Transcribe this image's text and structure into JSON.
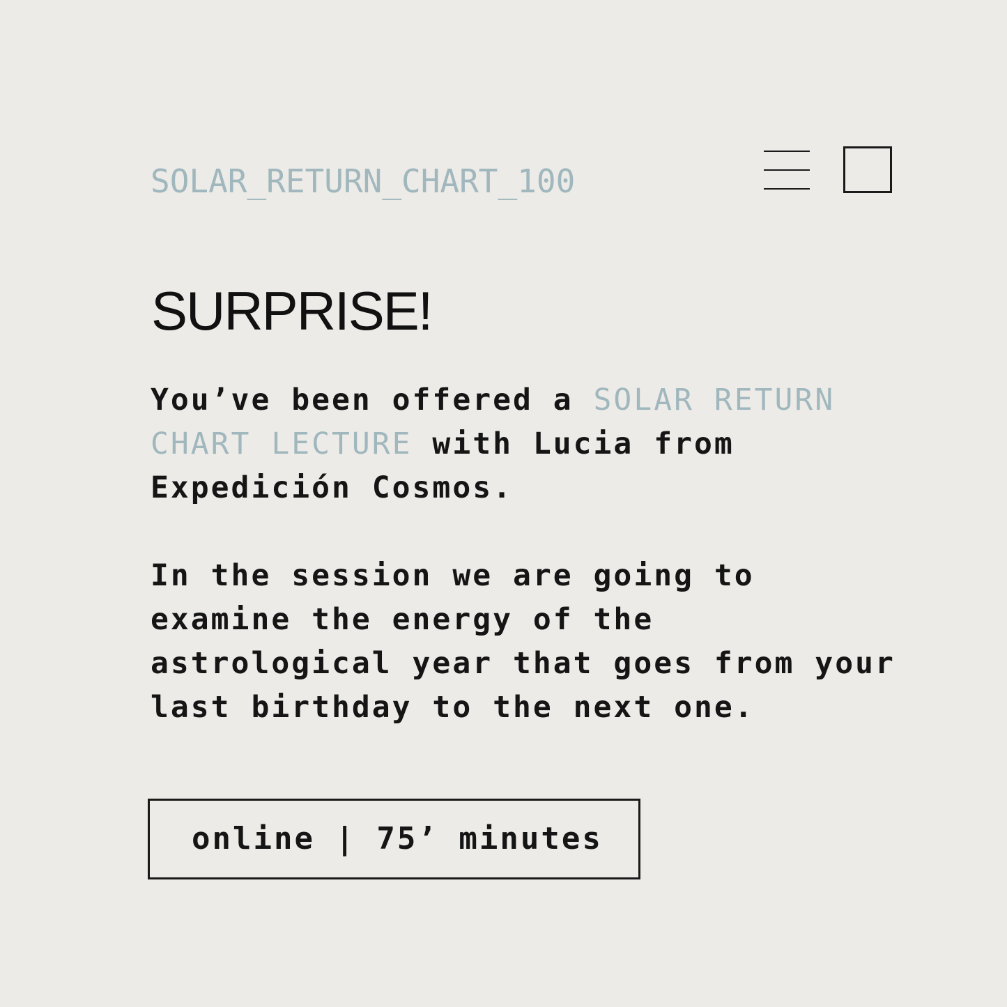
{
  "header": {
    "title": "SOLAR_RETURN_CHART_100",
    "menu_icon": "hamburger-menu-icon",
    "square_icon": "square-outline-icon"
  },
  "main": {
    "heading": "SURPRISE!",
    "intro": {
      "before": "You’ve been offered a ",
      "highlight": "SOLAR RETURN CHART LECTURE",
      "after": " with Lucia from Expedición Cosmos."
    },
    "description": "In the session we are going to examine the energy of the astrological year that goes from your last birthday to the next one.",
    "badge": "online | 75’ minutes"
  },
  "colors": {
    "background": "#edebe7",
    "accent": "#9fb7bd",
    "text": "#151515"
  }
}
